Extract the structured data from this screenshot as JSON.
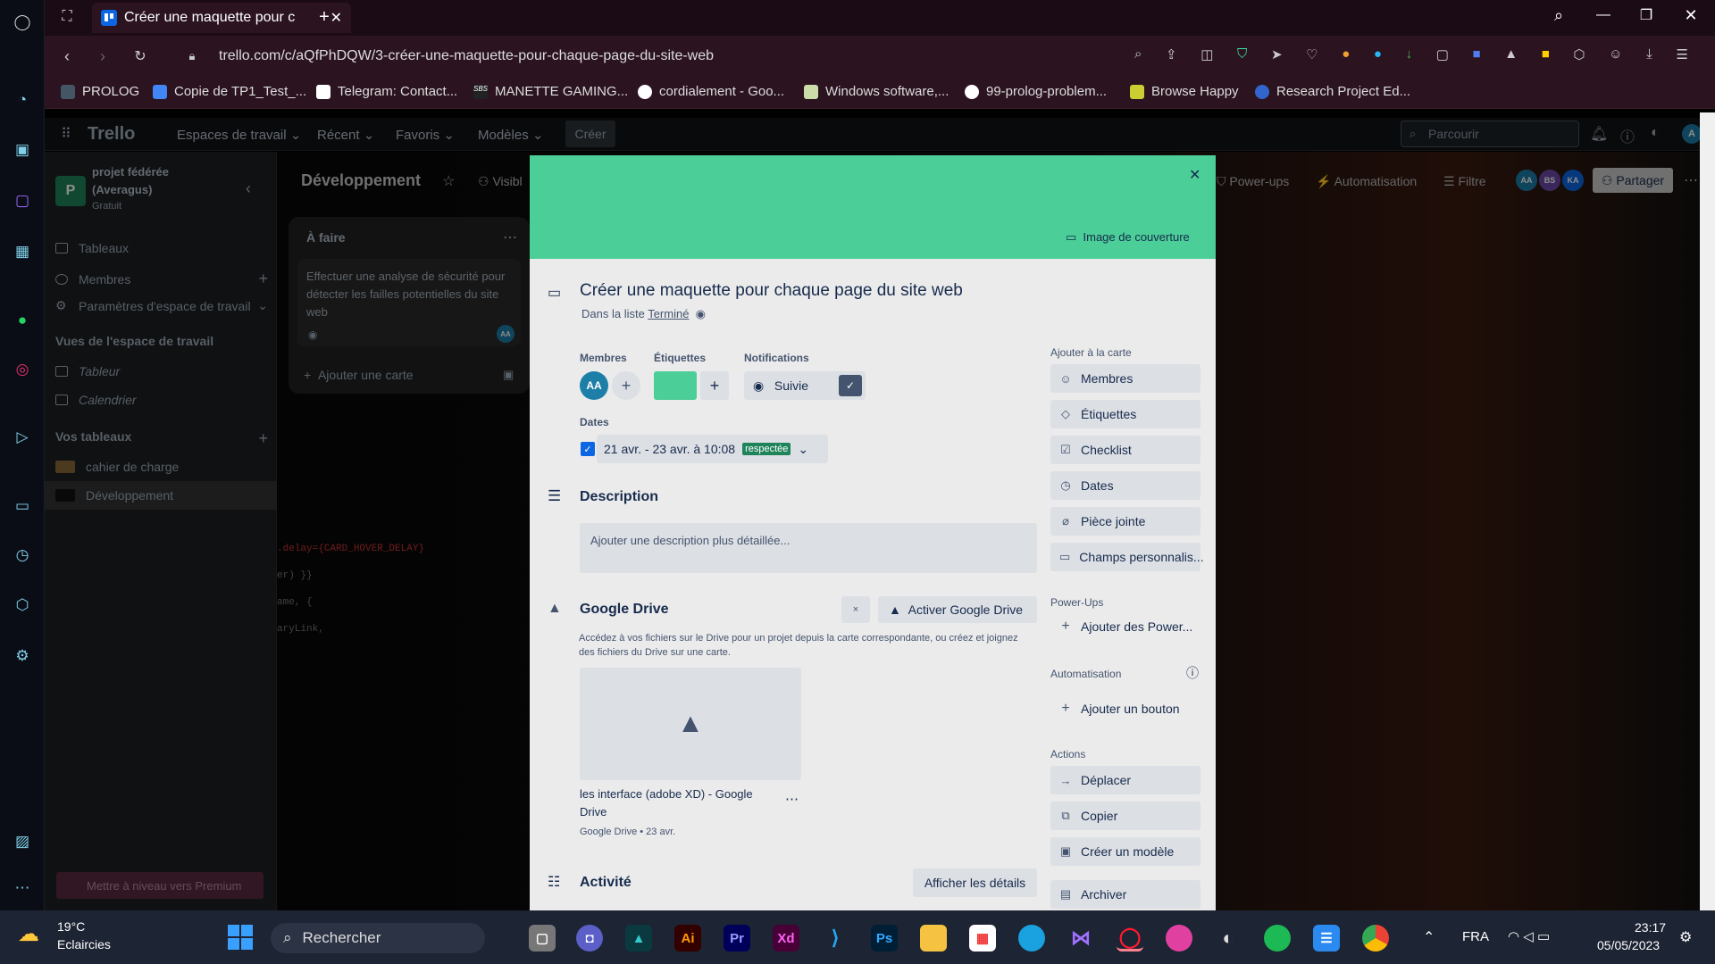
{
  "browser": {
    "tab_title": "Créer une maquette pour c",
    "url": "trello.com/c/aQfPhDQW/3-créer-une-maquette-pour-chaque-page-du-site-web"
  },
  "bookmarks": [
    "PROLOG",
    "Copie de TP1_Test_...",
    "Telegram: Contact...",
    "MANETTE GAMING...",
    "cordialement - Goo...",
    "Windows software,...",
    "99-prolog-problem...",
    "Browse Happy",
    "Research Project Ed..."
  ],
  "trello": {
    "logo": "Trello",
    "nav": [
      "Espaces de travail",
      "Récent",
      "Favoris",
      "Modèles"
    ],
    "create": "Créer",
    "search_placeholder": "Parcourir"
  },
  "workspace": {
    "name": "projet fédérée (Averagus)",
    "plan": "Gratuit",
    "items": [
      "Tableaux",
      "Membres",
      "Paramètres d'espace de travail"
    ],
    "views_title": "Vues de l'espace de travail",
    "views": [
      "Tableur",
      "Calendrier"
    ],
    "boards_title": "Vos tableaux",
    "boards": [
      "cahier de charge",
      "Développement"
    ],
    "upgrade": "Mettre à niveau vers Premium"
  },
  "board": {
    "title": "Développement",
    "visibility": "Visibl",
    "powerups": "Power-ups",
    "automation": "Automatisation",
    "filter": "Filtre",
    "share": "Partager",
    "members": [
      "AA",
      "BS",
      "KA"
    ]
  },
  "list": {
    "title": "À faire",
    "card": "Effectuer une analyse de sécurité pour détecter les failles potentielles du site web",
    "card_member": "AA",
    "add": "Ajouter une carte"
  },
  "card": {
    "cover_button": "Image de couverture",
    "title": "Créer une maquette pour chaque page du site web",
    "in_list_prefix": "Dans la liste",
    "list_name": "Terminé",
    "members_label": "Membres",
    "member": "AA",
    "labels_label": "Étiquettes",
    "label_color": "#4bce97",
    "notifications_label": "Notifications",
    "watch": "Suivie",
    "dates_label": "Dates",
    "date_range": "21 avr. - 23 avr. à 10:08",
    "date_status": "respectée",
    "description_title": "Description",
    "description_placeholder": "Ajouter une description plus détaillée...",
    "gdrive_title": "Google Drive",
    "gdrive_close": "×",
    "gdrive_activate": "Activer Google Drive",
    "gdrive_desc": "Accédez à vos fichiers sur le Drive pour un projet depuis la carte correspondante, ou créez et joignez des fichiers du Drive sur une carte.",
    "attachment_name": "les interface (adobe XD) - Google Drive",
    "attachment_meta": "Google Drive • 23 avr.",
    "activity_title": "Activité",
    "activity_details": "Afficher les détails",
    "add_to_card": "Ajouter à la carte",
    "side": [
      "Membres",
      "Étiquettes",
      "Checklist",
      "Dates",
      "Pièce jointe",
      "Champs personnalis..."
    ],
    "powerups_title": "Power-Ups",
    "powerups_add": "Ajouter des Power...",
    "automation_title": "Automatisation",
    "automation_add": "Ajouter un bouton",
    "actions_title": "Actions",
    "actions": [
      "Déplacer",
      "Copier",
      "Créer un modèle",
      "Archiver"
    ]
  },
  "taskbar": {
    "temp": "19°C",
    "weather": "Eclaircies",
    "search": "Rechercher",
    "lang": "FRA",
    "time": "23:17",
    "date": "05/05/2023"
  }
}
